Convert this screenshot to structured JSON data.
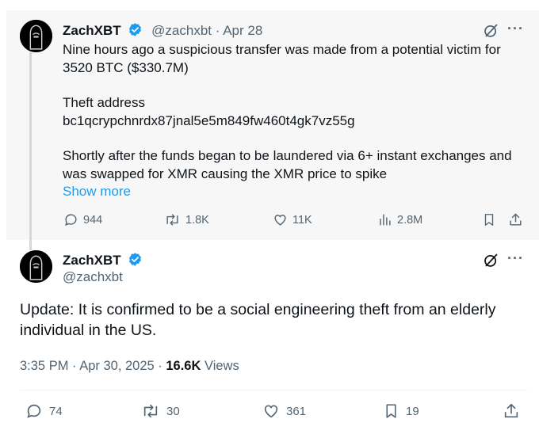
{
  "tweet1": {
    "display_name": "ZachXBT",
    "handle": "@zachxbt",
    "separator": "·",
    "date": "Apr 28",
    "lines": [
      "Nine hours ago a suspicious transfer was made from a potential victim for",
      "3520 BTC ($330.7M)",
      "Theft address",
      "bc1qcrypchnrdx87jnal5e5m849fw460t4gk7vz55g",
      "Shortly after the funds began to be laundered via 6+ instant exchanges and",
      "was swapped for XMR causing the XMR price to spike"
    ],
    "show_more": "Show more",
    "stats": {
      "replies": "944",
      "reposts": "1.8K",
      "likes": "11K",
      "views": "2.8M"
    }
  },
  "tweet2": {
    "display_name": "ZachXBT",
    "handle": "@zachxbt",
    "text": "Update: It is confirmed to be a social engineering theft from an elderly individual in the US.",
    "time": "3:35 PM · Apr 30, 2025 ·",
    "views_count": "16.6K",
    "views_label": "Views",
    "stats": {
      "replies": "74",
      "reposts": "30",
      "likes": "361",
      "bookmarks": "19"
    }
  },
  "icons": [
    "grok-icon",
    "more-icon",
    "reply-icon",
    "repost-icon",
    "like-icon",
    "views-icon",
    "bookmark-icon",
    "share-icon",
    "verified-icon"
  ],
  "colors": {
    "verified": "#1d9bf0",
    "link": "#1d9bf0",
    "muted": "#536471",
    "text": "#0f1419"
  }
}
